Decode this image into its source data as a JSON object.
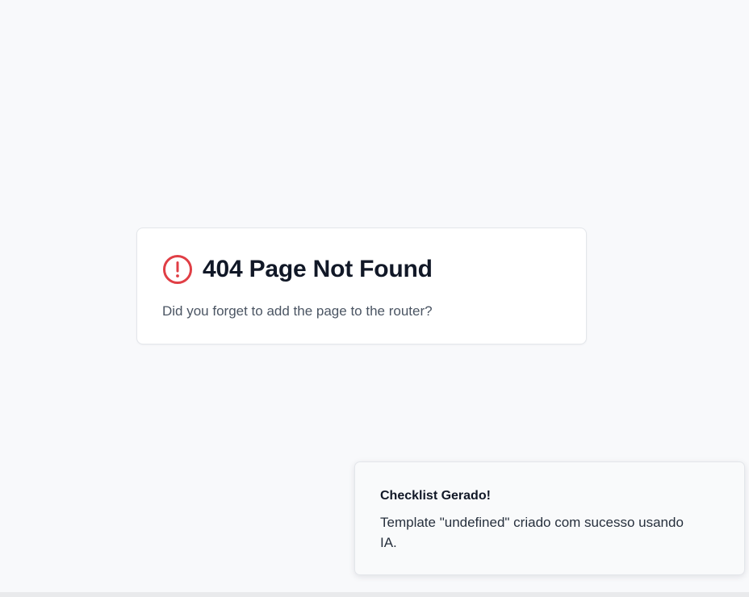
{
  "not_found": {
    "icon": "alert-circle-icon",
    "title": "404 Page Not Found",
    "message": "Did you forget to add the page to the router?"
  },
  "toast": {
    "title": "Checklist Gerado!",
    "description": "Template \"undefined\" criado com sucesso usando IA."
  },
  "colors": {
    "background": "#f8f9fb",
    "card": "#ffffff",
    "error_icon": "#e03e45",
    "title": "#111827",
    "muted_text": "#4b5563"
  }
}
